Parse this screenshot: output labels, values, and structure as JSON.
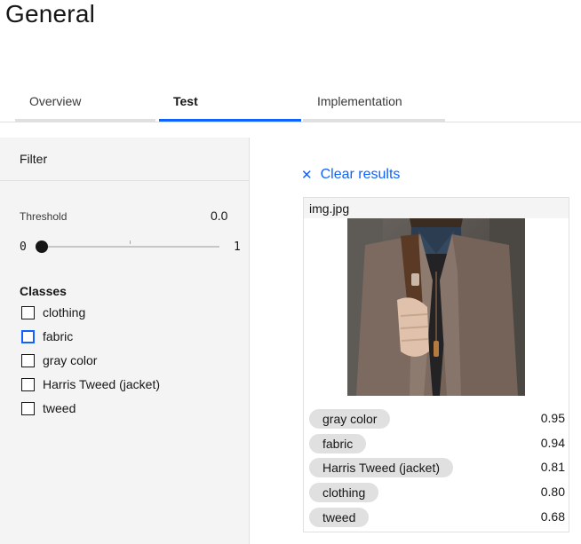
{
  "page": {
    "title": "General"
  },
  "tabs": [
    {
      "label": "Overview",
      "active": false
    },
    {
      "label": "Test",
      "active": true
    },
    {
      "label": "Implementation",
      "active": false
    }
  ],
  "filter": {
    "title": "Filter",
    "threshold_label": "Threshold",
    "threshold_value": "0.0",
    "slider_min": "0",
    "slider_max": "1",
    "slider_level": 0.0,
    "classes_title": "Classes",
    "classes": [
      {
        "label": "clothing",
        "checked": false,
        "focused": false
      },
      {
        "label": "fabric",
        "checked": false,
        "focused": true
      },
      {
        "label": "gray color",
        "checked": false,
        "focused": false
      },
      {
        "label": "Harris Tweed (jacket)",
        "checked": false,
        "focused": false
      },
      {
        "label": "tweed",
        "checked": false,
        "focused": false
      }
    ]
  },
  "results": {
    "clear_label": "Clear results",
    "clear_icon": "close-icon",
    "filename": "img.jpg",
    "items": [
      {
        "label": "gray color",
        "score": "0.95"
      },
      {
        "label": "fabric",
        "score": "0.94"
      },
      {
        "label": "Harris Tweed (jacket)",
        "score": "0.81"
      },
      {
        "label": "clothing",
        "score": "0.80"
      },
      {
        "label": "tweed",
        "score": "0.68"
      }
    ]
  },
  "colors": {
    "accent": "#0f62fe",
    "panel_bg": "#f4f4f4",
    "tag_bg": "#e0e0e0"
  }
}
